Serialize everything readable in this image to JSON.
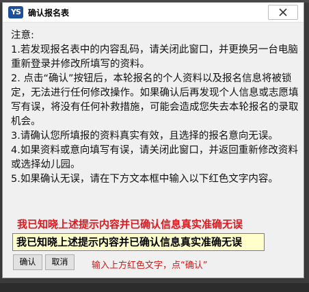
{
  "window": {
    "logo_text": "YS",
    "title": "确认报名表"
  },
  "notice": {
    "heading": "注意:",
    "items": [
      "1.若发现报名表中的内容乱码，请关闭此窗口，并更换另一台电脑重新登录并修改所填写的资料。",
      "2. 点击“确认”按钮后，本轮报名的个人资料以及报名信息将被锁定，无法进行任何修改操作。如果确认后再发现个人信息或志愿填写有误，将没有任何补救措施，可能会造成您失去本轮报名的录取机会。",
      "3.请确认您所填报的资料真实有效，且选择的报名意向无误。",
      "4.如果资料或意向填写有误，请关闭此窗口，并返回重新修改资料或选择幼儿园。",
      "5.如果确认无误，请在下方文本框中输入以下红色文字内容。"
    ]
  },
  "confirm_phrase": "我已知晓上述提示内容并已确认信息真实准确无误",
  "input": {
    "value": "我已知晓上述提示内容并已确认信息真实准确无误"
  },
  "buttons": {
    "confirm_label": "确认",
    "cancel_label": "取消"
  },
  "hint": "输入上方红色文字，点“确认”",
  "colors": {
    "accent_red": "#e0171e",
    "input_bg": "#ffffcc",
    "logo_blue": "#1e4f9c"
  }
}
